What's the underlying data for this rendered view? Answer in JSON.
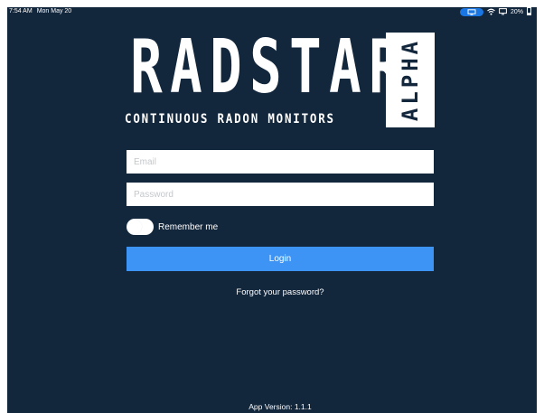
{
  "status_bar": {
    "time": "7:54 AM",
    "date": "Mon May 20",
    "battery": "20%",
    "indicators": [
      "screen-mirroring-icon",
      "wifi-icon",
      "airplay-icon",
      "battery-icon"
    ]
  },
  "logo": {
    "word": [
      "R",
      "A",
      "D",
      "S",
      "T",
      "A",
      "R"
    ],
    "tagline": "CONTINUOUS RADON MONITORS",
    "badge": "ALPHA"
  },
  "form": {
    "email_placeholder": "Email",
    "email_value": "",
    "password_placeholder": "Password",
    "password_value": "",
    "remember_label": "Remember me",
    "remember_checked": false,
    "login_label": "Login",
    "forgot_label": "Forgot your password?"
  },
  "footer": {
    "app_version": "App Version: 1.1.1"
  },
  "colors": {
    "background": "#12263c",
    "accent": "#3d94f4",
    "status_pill": "#1a76e3"
  }
}
